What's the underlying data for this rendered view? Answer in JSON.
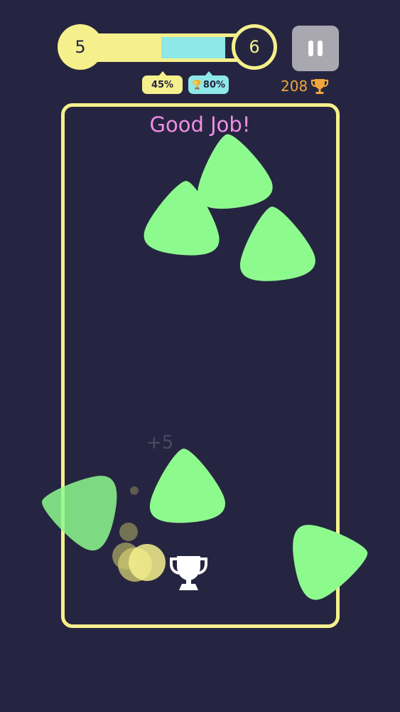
{
  "level": {
    "current": "5",
    "next": "6",
    "progress_fraction": 0.45,
    "best_fraction": 0.8
  },
  "badges": {
    "progress_label": "45%",
    "best_label": "80%"
  },
  "score": {
    "value": "208"
  },
  "messages": {
    "praise": "Good Job!",
    "points_gained": "+5"
  },
  "colors": {
    "background": "#262541",
    "accent_yellow": "#f5f08c",
    "accent_cyan": "#8ee8e6",
    "shape_green": "#8dfa8e",
    "praise_pink": "#f08ee6",
    "score_orange": "#f0a63b",
    "pause_gray": "#a9a8b0"
  },
  "icons": {
    "pause": "pause-icon",
    "trophy": "trophy-icon",
    "goal_trophy": "goal-trophy-icon",
    "ball": "ball-icon"
  }
}
